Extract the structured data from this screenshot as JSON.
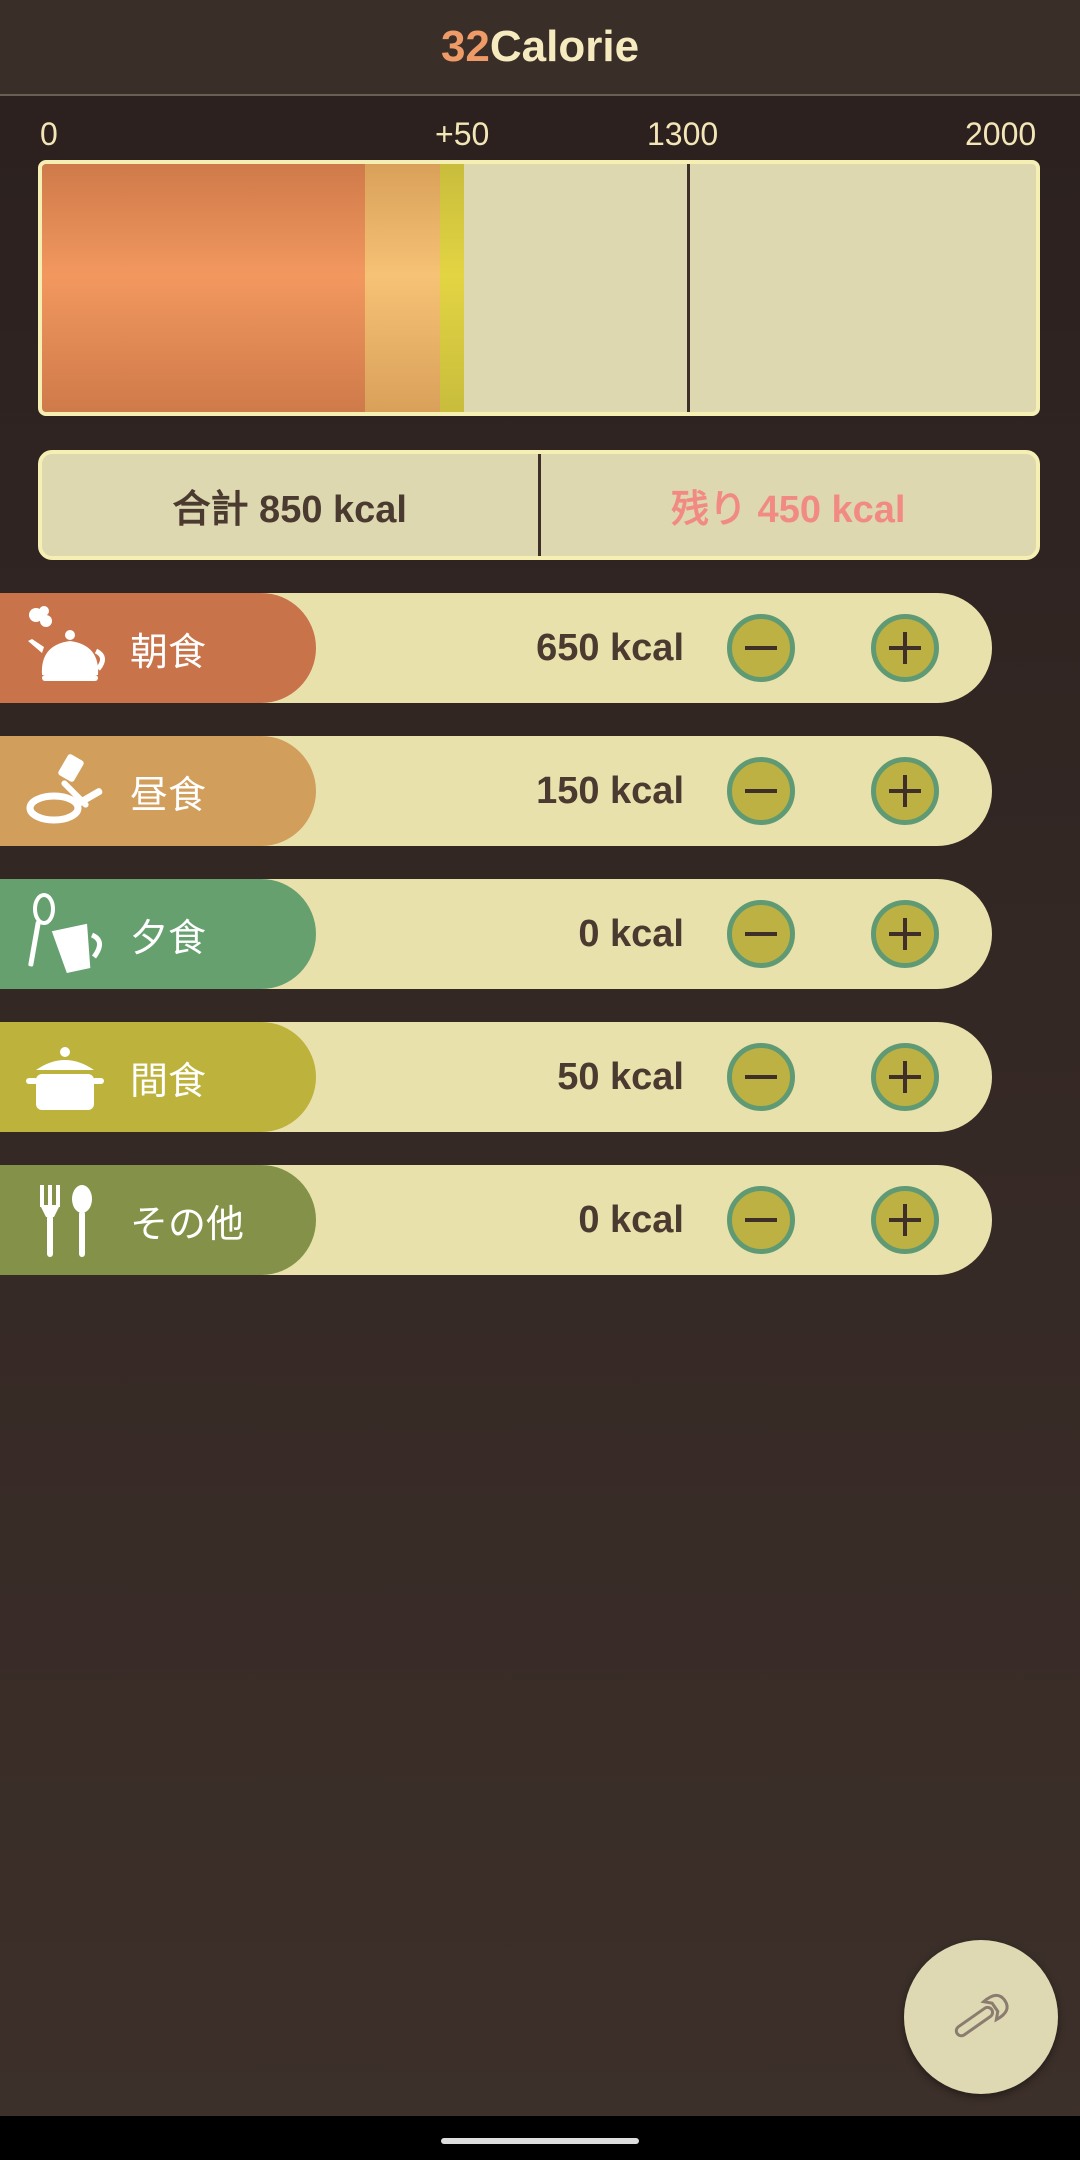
{
  "header": {
    "title_number": "32",
    "title_text": "Calorie"
  },
  "gauge": {
    "labels": {
      "zero": "0",
      "plus": "+50",
      "target": "1300",
      "max": "2000"
    },
    "max": 2000,
    "target": 1300,
    "segments": [
      {
        "meal": "breakfast",
        "kcal": 650,
        "color": "#f2985f"
      },
      {
        "meal": "lunch",
        "kcal": 150,
        "color": "#f6c275"
      },
      {
        "meal": "snack",
        "kcal": 50,
        "color": "#e3d443"
      }
    ]
  },
  "summary": {
    "total_label": "合計 850 kcal",
    "remaining_label": "残り 450 kcal"
  },
  "meals": [
    {
      "name": "朝食",
      "kcal": "650 kcal",
      "color": "#c9734b",
      "icon": "teapot-icon"
    },
    {
      "name": "昼食",
      "kcal": "150 kcal",
      "color": "#d19e5c",
      "icon": "frying-pan-icon"
    },
    {
      "name": "夕食",
      "kcal": "0 kcal",
      "color": "#66a06f",
      "icon": "whisk-measuring-cup-icon"
    },
    {
      "name": "間食",
      "kcal": "50 kcal",
      "color": "#bdb23b",
      "icon": "pot-icon"
    },
    {
      "name": "その他",
      "kcal": "0 kcal",
      "color": "#839248",
      "icon": "fork-spoon-icon"
    }
  ],
  "fab": {
    "icon": "wrench-icon"
  }
}
